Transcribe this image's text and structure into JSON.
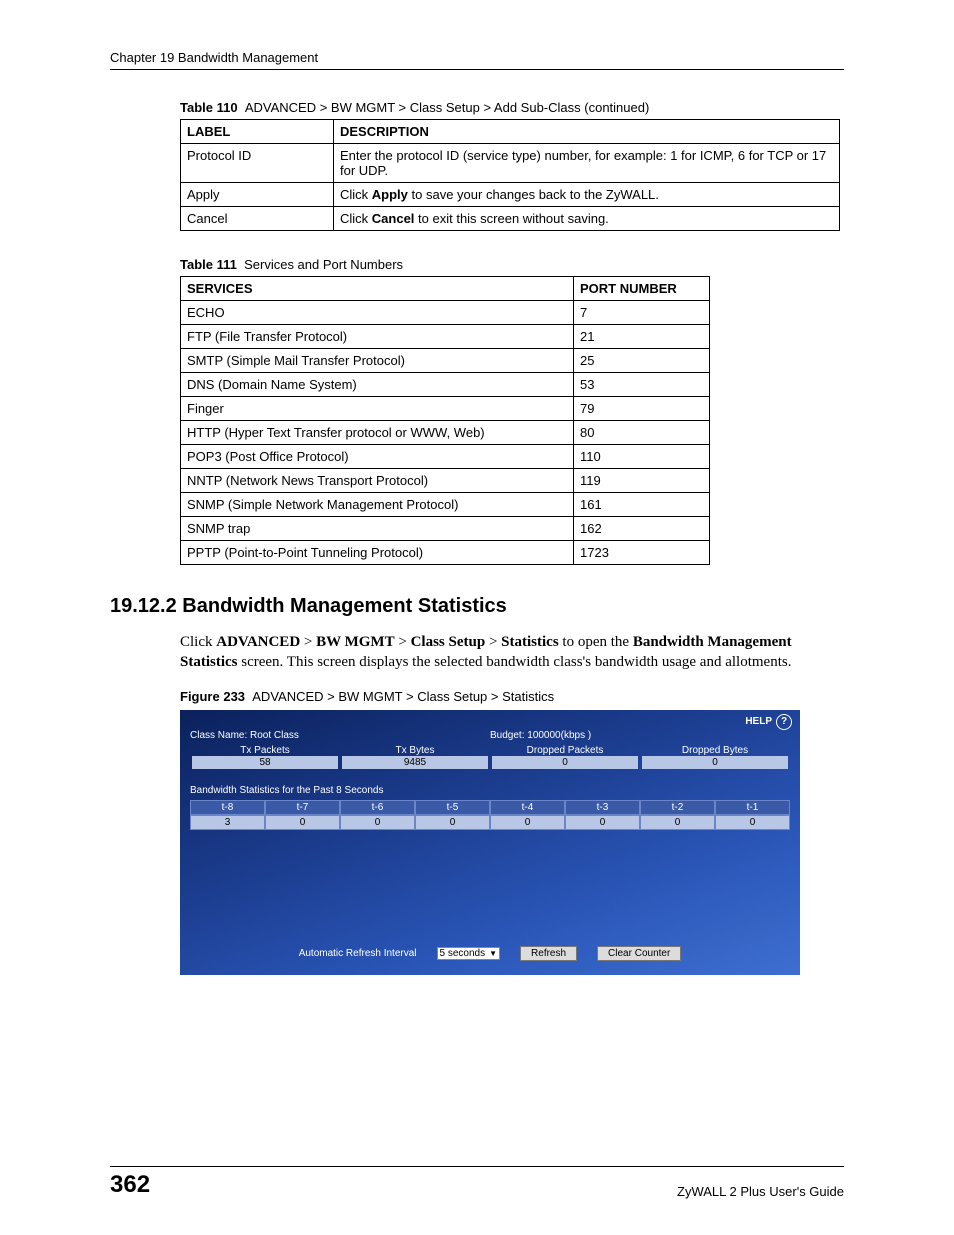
{
  "header": {
    "chapter": "Chapter 19 Bandwidth Management"
  },
  "table110": {
    "caption_bold": "Table 110",
    "caption_rest": "ADVANCED > BW MGMT > Class Setup > Add Sub-Class (continued)",
    "headers": {
      "label": "LABEL",
      "description": "DESCRIPTION"
    },
    "rows": [
      {
        "label": "Protocol ID",
        "desc": "Enter the protocol ID (service type) number, for example: 1 for ICMP, 6 for TCP or 17 for UDP."
      },
      {
        "label": "Apply",
        "desc_pre": "Click ",
        "desc_bold": "Apply",
        "desc_post": " to save your changes back to the ZyWALL."
      },
      {
        "label": "Cancel",
        "desc_pre": "Click ",
        "desc_bold": "Cancel",
        "desc_post": " to exit this screen without saving."
      }
    ]
  },
  "table111": {
    "caption_bold": "Table 111",
    "caption_rest": "Services and Port Numbers",
    "headers": {
      "services": "SERVICES",
      "port": "PORT NUMBER"
    },
    "rows": [
      {
        "s": "ECHO",
        "p": "7"
      },
      {
        "s": "FTP (File Transfer Protocol)",
        "p": "21"
      },
      {
        "s": "SMTP (Simple Mail Transfer Protocol)",
        "p": "25"
      },
      {
        "s": "DNS (Domain Name System)",
        "p": "53"
      },
      {
        "s": "Finger",
        "p": "79"
      },
      {
        "s": "HTTP (Hyper Text Transfer protocol or WWW, Web)",
        "p": "80"
      },
      {
        "s": "POP3 (Post Office Protocol)",
        "p": "110"
      },
      {
        "s": "NNTP (Network News Transport Protocol)",
        "p": "119"
      },
      {
        "s": "SNMP (Simple Network Management Protocol)",
        "p": "161"
      },
      {
        "s": "SNMP trap",
        "p": "162"
      },
      {
        "s": "PPTP (Point-to-Point Tunneling Protocol)",
        "p": "1723"
      }
    ]
  },
  "section": {
    "heading": "19.12.2  Bandwidth Management Statistics",
    "p_pre": "Click ",
    "p_b1": "ADVANCED",
    "p_s1": " > ",
    "p_b2": "BW MGMT",
    "p_s2": " > ",
    "p_b3": "Class Setup",
    "p_s3": " > ",
    "p_b4": "Statistics",
    "p_mid": " to open the ",
    "p_b5": "Bandwidth Management Statistics",
    "p_post": " screen. This screen displays the selected bandwidth class's bandwidth usage and allotments."
  },
  "figure": {
    "caption_bold": "Figure 233",
    "caption_rest": "ADVANCED > BW MGMT > Class Setup > Statistics"
  },
  "screenshot": {
    "help": "HELP",
    "class_name_label": "Class Name: Root Class",
    "budget_label": "Budget: 100000(kbps )",
    "cols": [
      "Tx Packets",
      "Tx Bytes",
      "Dropped Packets",
      "Dropped Bytes"
    ],
    "vals": [
      "58",
      "9485",
      "0",
      "0"
    ],
    "past_label": "Bandwidth Statistics for the Past 8 Seconds",
    "time_headers": [
      "t-8",
      "t-7",
      "t-6",
      "t-5",
      "t-4",
      "t-3",
      "t-2",
      "t-1"
    ],
    "time_values": [
      "3",
      "0",
      "0",
      "0",
      "0",
      "0",
      "0",
      "0"
    ],
    "refresh_label": "Automatic Refresh Interval",
    "refresh_value": "5 seconds",
    "btn_refresh": "Refresh",
    "btn_clear": "Clear Counter"
  },
  "footer": {
    "page": "362",
    "guide": "ZyWALL 2 Plus User's Guide"
  }
}
